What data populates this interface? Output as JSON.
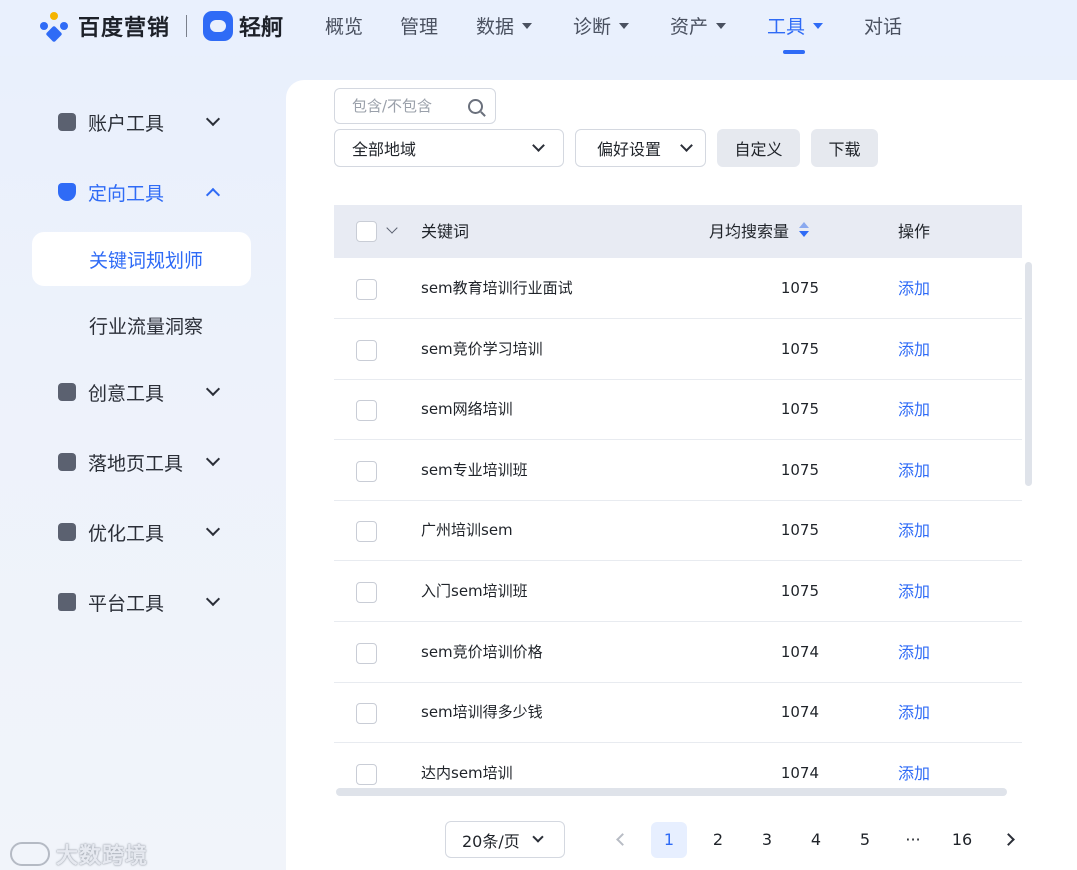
{
  "header": {
    "brand_name": "百度营销",
    "product_name": "轻舸",
    "nav": [
      {
        "label": "概览",
        "has_dropdown": false
      },
      {
        "label": "管理",
        "has_dropdown": false
      },
      {
        "label": "数据",
        "has_dropdown": true
      },
      {
        "label": "诊断",
        "has_dropdown": true
      },
      {
        "label": "资产",
        "has_dropdown": true
      },
      {
        "label": "工具",
        "has_dropdown": true,
        "active": true
      },
      {
        "label": "对话",
        "has_dropdown": false
      }
    ]
  },
  "sidebar": {
    "groups": [
      {
        "label": "账户工具",
        "icon": "account-icon",
        "expanded": false
      },
      {
        "label": "定向工具",
        "icon": "targeting-icon",
        "expanded": true,
        "active": true,
        "items": [
          {
            "label": "关键词规划师",
            "active": true
          },
          {
            "label": "行业流量洞察",
            "active": false
          }
        ]
      },
      {
        "label": "创意工具",
        "icon": "image-icon",
        "expanded": false
      },
      {
        "label": "落地页工具",
        "icon": "landing-page-icon",
        "expanded": false
      },
      {
        "label": "优化工具",
        "icon": "chart-icon",
        "expanded": false
      },
      {
        "label": "平台工具",
        "icon": "cube-icon",
        "expanded": false
      }
    ]
  },
  "watermark": "大数跨境",
  "toolbar": {
    "search_placeholder": "包含/不包含",
    "region_select": "全部地域",
    "preference_select": "偏好设置",
    "customize_label": "自定义",
    "download_label": "下载"
  },
  "table": {
    "headers": {
      "keyword": "关键词",
      "monthly_volume": "月均搜索量",
      "action": "操作"
    },
    "rows": [
      {
        "keyword": "sem教育培训行业面试",
        "volume": "1075",
        "action": "添加"
      },
      {
        "keyword": "sem竞价学习培训",
        "volume": "1075",
        "action": "添加"
      },
      {
        "keyword": "sem网络培训",
        "volume": "1075",
        "action": "添加"
      },
      {
        "keyword": "sem专业培训班",
        "volume": "1075",
        "action": "添加"
      },
      {
        "keyword": "广州培训sem",
        "volume": "1075",
        "action": "添加"
      },
      {
        "keyword": "入门sem培训班",
        "volume": "1075",
        "action": "添加"
      },
      {
        "keyword": "sem竞价培训价格",
        "volume": "1074",
        "action": "添加"
      },
      {
        "keyword": "sem培训得多少钱",
        "volume": "1074",
        "action": "添加"
      },
      {
        "keyword": "达内sem培训",
        "volume": "1074",
        "action": "添加"
      }
    ]
  },
  "pagination": {
    "page_size": "20条/页",
    "pages": [
      "1",
      "2",
      "3",
      "4",
      "5",
      "···",
      "16"
    ],
    "current": "1"
  },
  "colors": {
    "accent": "#2f6bf6",
    "header_row": "#e8ebf3",
    "button_bg": "#e6e9ef"
  }
}
